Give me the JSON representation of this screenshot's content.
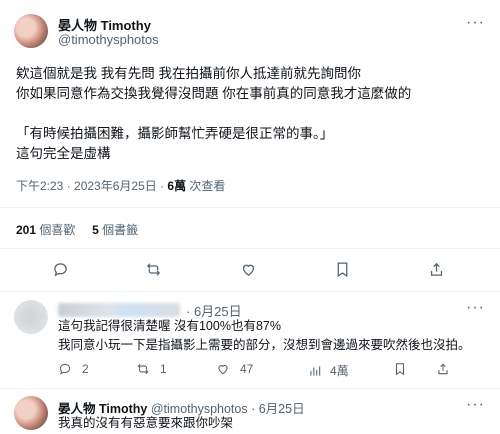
{
  "tweet": {
    "author_name": "晏人物 Timothy",
    "author_handle": "@timothysphotos",
    "lines": [
      "欸這個就是我 我有先問 我在拍攝前你人抵達前就先詢問你",
      "你如果同意作為交換我覺得沒問題 你在事前真的同意我才這麼做的",
      "",
      "「有時候拍攝困難，攝影師幫忙弄硬是很正常的事。」",
      "這句完全是虛構"
    ],
    "time": "下午2:23 · 2023年6月25日 · ",
    "views_count": "6萬",
    "views_label": " 次查看",
    "likes_count": "201",
    "likes_label": "個喜歡",
    "bookmarks_count": "5",
    "bookmarks_label": "個書籤"
  },
  "reply1": {
    "date": "· 6月25日",
    "lines": [
      "這句我記得很清楚喔 沒有100%也有87%",
      "我同意小玩一下是指攝影上需要的部分，沒想到會邊過來要吹然後也沒拍。"
    ],
    "replies": "2",
    "retweets": "1",
    "likes": "47",
    "views": "4萬"
  },
  "reply2": {
    "author_name": "晏人物 Timothy",
    "author_handle": "@timothysphotos",
    "date": "· 6月25日",
    "line": "我真的沒有有惡意要來跟你吵架"
  },
  "icons": {
    "more": "more-horizontal-icon",
    "reply": "reply-icon",
    "retweet": "retweet-icon",
    "like": "heart-icon",
    "bookmark": "bookmark-icon",
    "share": "share-icon",
    "views": "views-icon"
  },
  "more_glyph": "···"
}
